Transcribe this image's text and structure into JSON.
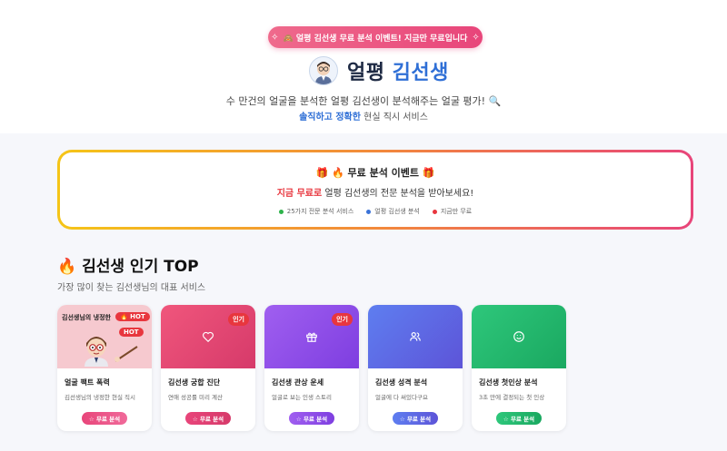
{
  "header": {
    "banner": "🙈 얼평 김선생 무료 분석 이벤트! 지금만 무료입니다",
    "brand_main": "얼평",
    "brand_accent": "김선생",
    "tagline": "수 만건의 얼굴을 분석한 얼평 김선생이 분석해주는 얼굴 평가! 🔍",
    "tagline2_strong": "솔직하고 정확한",
    "tagline2_rest": " 현실 직시 서비스"
  },
  "event": {
    "title": "🔥 무료 분석 이벤트",
    "sub_highlight": "지금 무료로",
    "sub_rest": " 얼평 김선생의 전문 분석을 받아보세요!",
    "points": [
      {
        "label": "25가지 전문 분석 서비스",
        "color": "#2db34a"
      },
      {
        "label": "얼평 김선생 분석",
        "color": "#3b73d8"
      },
      {
        "label": "지금만 무료",
        "color": "#e8363e"
      }
    ]
  },
  "section": {
    "title": "🔥 김선생 인기 TOP",
    "subtitle": "가장 많이 찾는 김선생님의 대표 서비스"
  },
  "cards": [
    {
      "title": "얼굴 팩트 폭력",
      "desc": "김선생님의 냉정한 현실 직시",
      "button": "☆ 무료 분석",
      "icon": "illustration",
      "illus_title": "김선생님의 냉정한",
      "illus_hot1": "🔥 HOT",
      "illus_hot2": "HOT",
      "bg": "#f6c9cf",
      "btn_bg": "linear-gradient(90deg,#e8457a,#f06a9a)"
    },
    {
      "title": "김선생 궁합 진단",
      "desc": "연애 성공률 미리 계산",
      "button": "☆ 무료 분석",
      "icon": "heart-icon",
      "badge": "인기",
      "bg": "linear-gradient(135deg,#f0567c,#d63a6a)",
      "btn_bg": "linear-gradient(90deg,#e8457a,#d63a6a)"
    },
    {
      "title": "김선생 관상 운세",
      "desc": "얼굴로 보는 인생 스토리",
      "button": "☆ 무료 분석",
      "icon": "gift-icon",
      "badge": "인기",
      "bg": "linear-gradient(135deg,#a05ff0,#7e3ee0)",
      "btn_bg": "linear-gradient(90deg,#a05ff0,#7e3ee0)"
    },
    {
      "title": "김선생 성격 분석",
      "desc": "얼굴에 다 써있다구요",
      "button": "☆ 무료 분석",
      "icon": "users-icon",
      "bg": "linear-gradient(135deg,#5e7ef0,#5d54d8)",
      "btn_bg": "linear-gradient(90deg,#5e7ef0,#5d54d8)"
    },
    {
      "title": "김선생 첫인상 분석",
      "desc": "3초 만에 결정되는 첫 인상",
      "button": "☆ 무료 분석",
      "icon": "smile-icon",
      "bg": "linear-gradient(135deg,#2ec77b,#1aa860)",
      "btn_bg": "linear-gradient(90deg,#2ec77b,#1aa860)"
    }
  ]
}
